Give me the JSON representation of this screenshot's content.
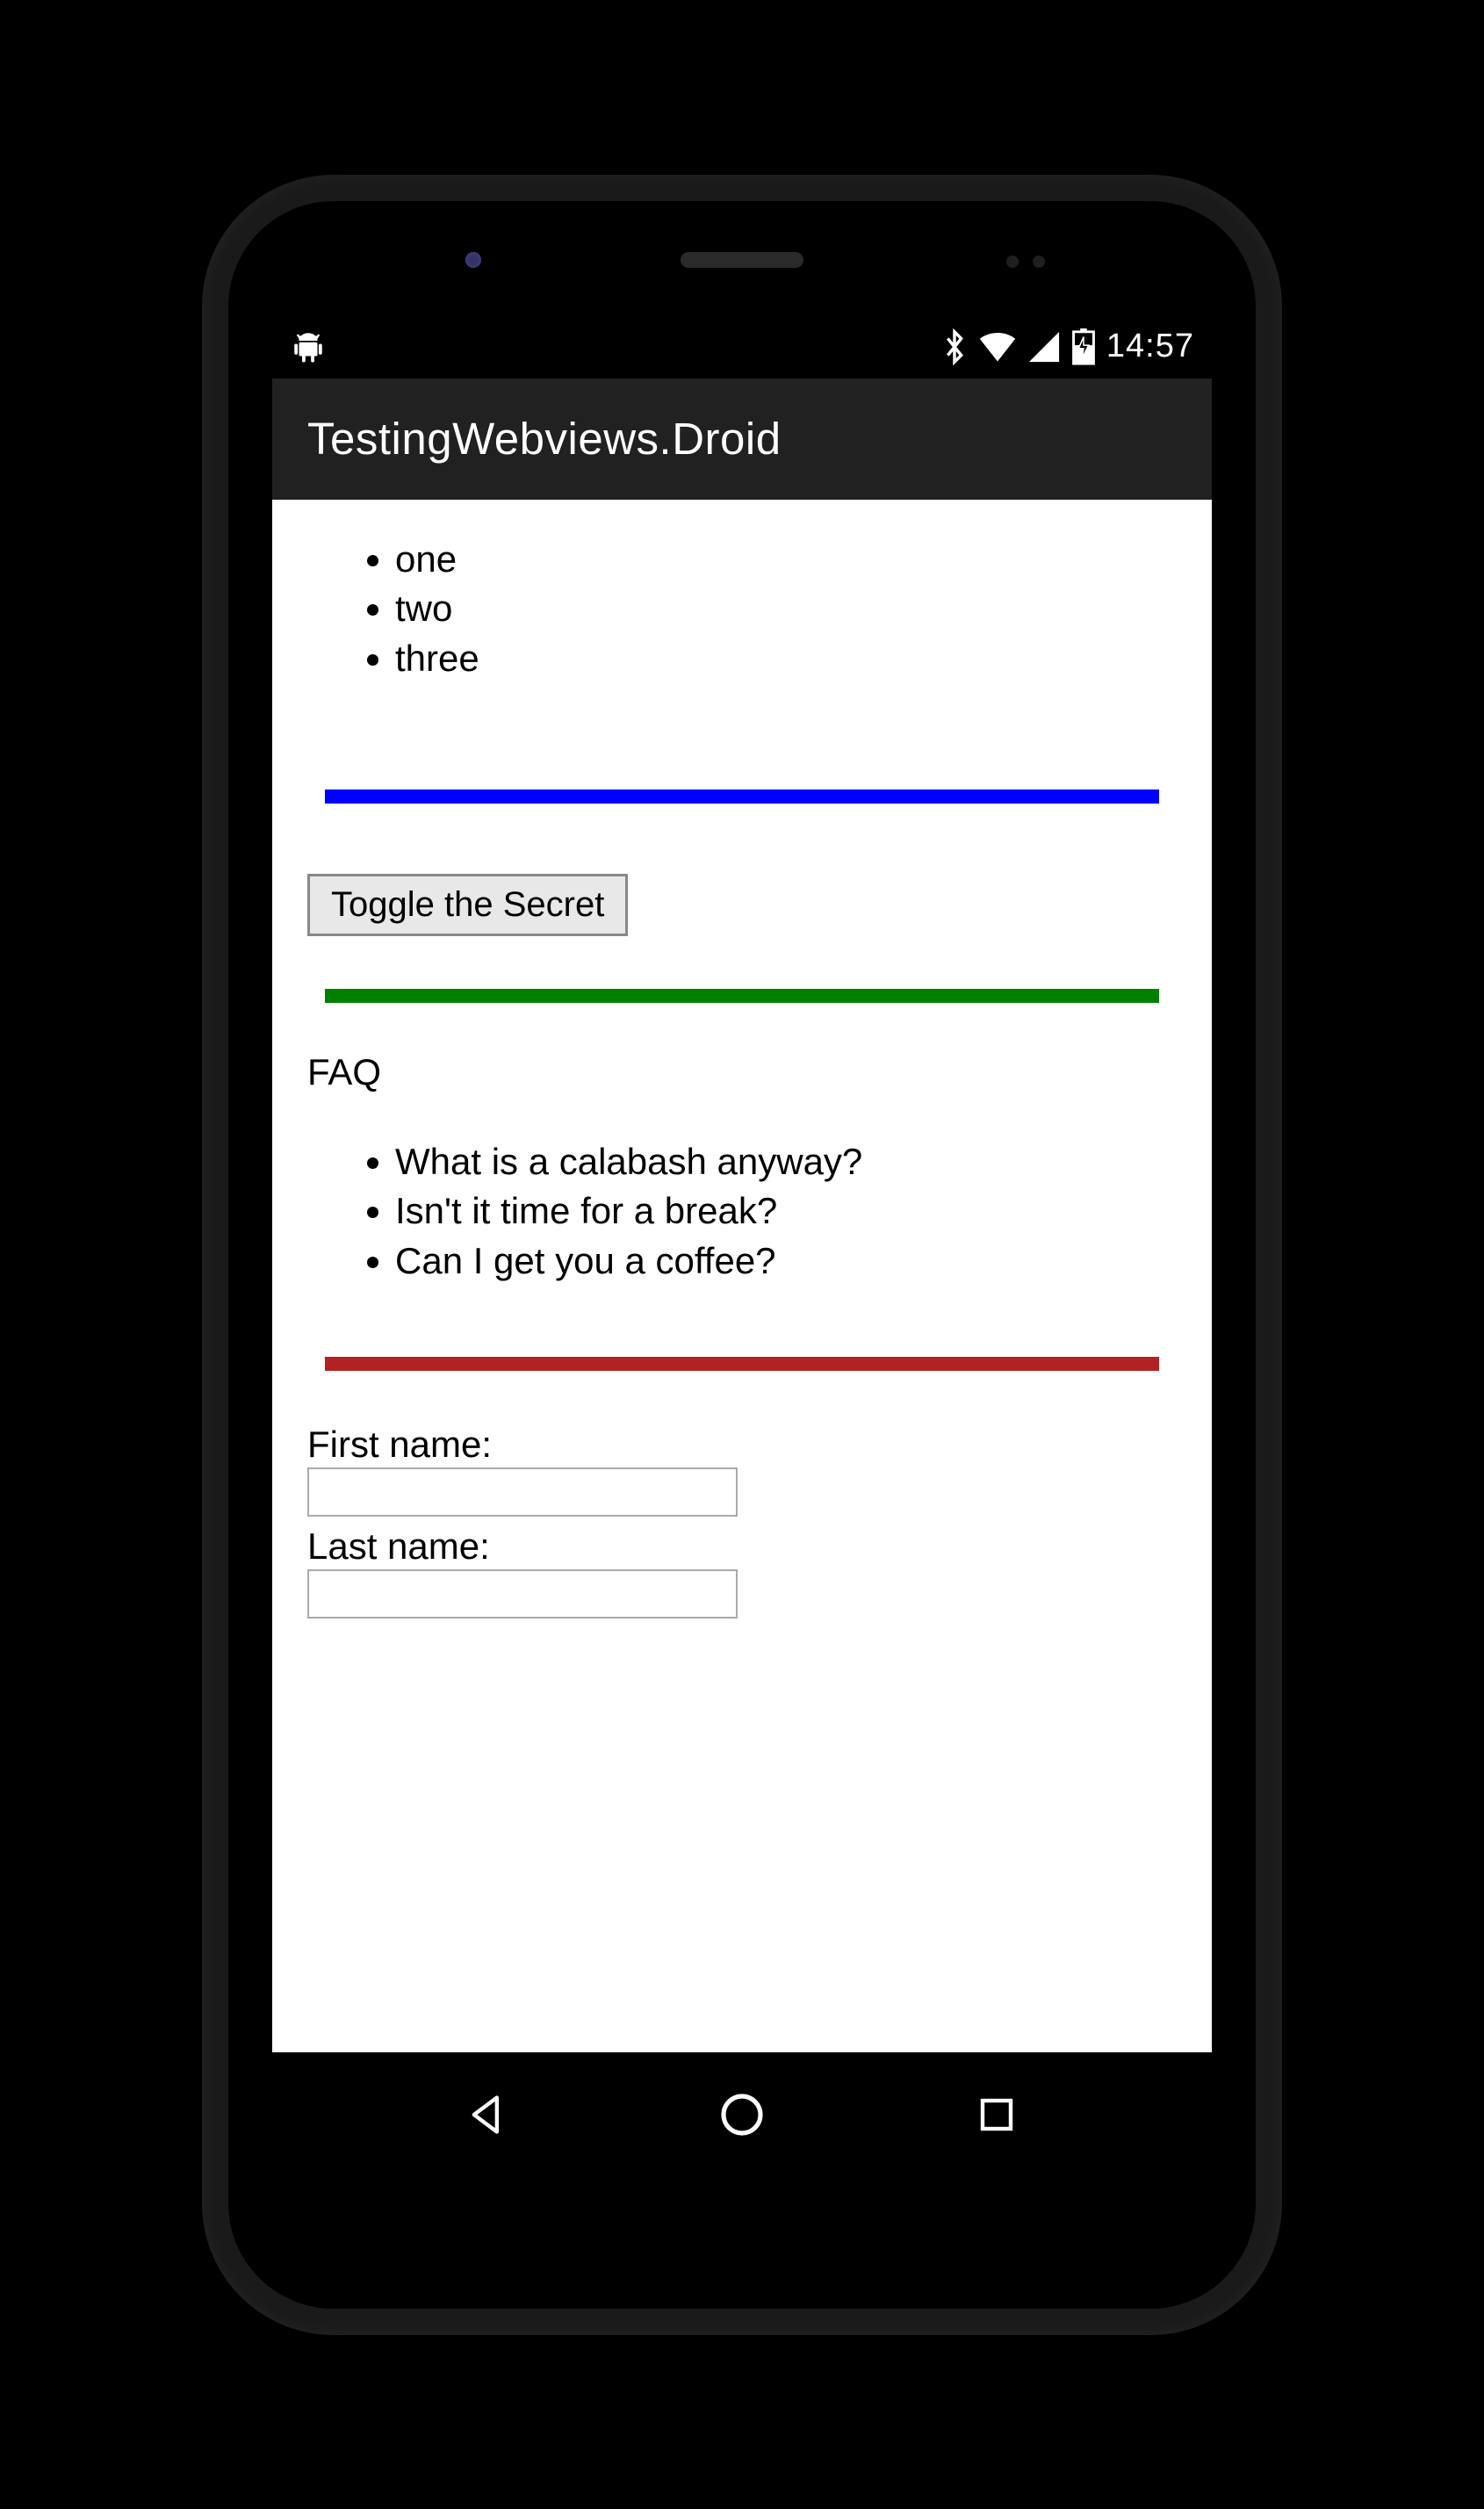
{
  "status_bar": {
    "time": "14:57"
  },
  "app_bar": {
    "title": "TestingWebviews.Droid"
  },
  "content": {
    "number_list": [
      "one",
      "two",
      "three"
    ],
    "toggle_button_label": "Toggle the Secret",
    "faq_heading": "FAQ",
    "faq_items": [
      "What is a calabash anyway?",
      "Isn't it time for a break?",
      "Can I get you a coffee?"
    ],
    "form": {
      "first_name_label": "First name:",
      "first_name_value": "",
      "last_name_label": "Last name:",
      "last_name_value": ""
    }
  },
  "dividers": {
    "blue": "#0000ff",
    "green": "#008000",
    "red": "#b22222"
  }
}
